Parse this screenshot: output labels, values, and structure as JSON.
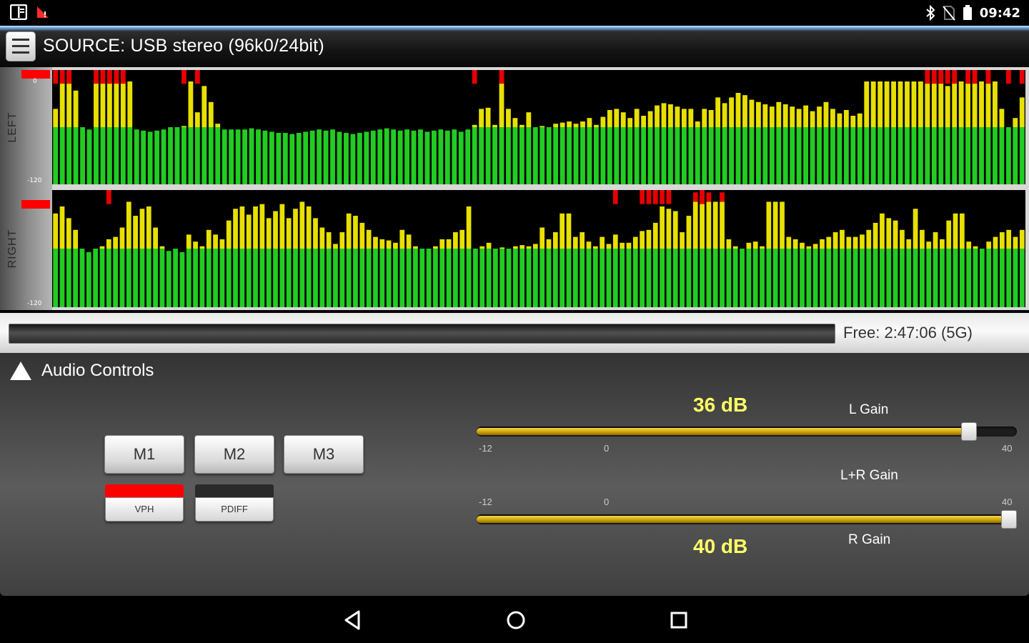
{
  "status_bar": {
    "left_icons": [
      "notes-icon",
      "signal-warning-icon"
    ],
    "right_icons": [
      "bluetooth-icon",
      "no-sim-icon",
      "battery-icon"
    ],
    "time": "09:42"
  },
  "header": {
    "source_label": "SOURCE: USB stereo (96k0/24bit)",
    "menu_icon": "hamburger-menu-icon"
  },
  "meters": {
    "scale_top": "0",
    "scale_bottom": "-120",
    "left": {
      "label": "LEFT",
      "levels": [
        0.66,
        0.9,
        0.9,
        0.82,
        0.5,
        0.48,
        0.9,
        0.9,
        0.9,
        0.9,
        0.9,
        0.9,
        0.48,
        0.47,
        0.46,
        0.47,
        0.48,
        0.5,
        0.5,
        0.51,
        0.9,
        0.63,
        0.86,
        0.72,
        0.53,
        0.48,
        0.48,
        0.48,
        0.48,
        0.49,
        0.48,
        0.47,
        0.46,
        0.45,
        0.45,
        0.44,
        0.45,
        0.46,
        0.47,
        0.48,
        0.47,
        0.48,
        0.46,
        0.45,
        0.44,
        0.45,
        0.46,
        0.47,
        0.48,
        0.49,
        0.48,
        0.47,
        0.48,
        0.47,
        0.48,
        0.46,
        0.47,
        0.48,
        0.47,
        0.48,
        0.46,
        0.48,
        0.52,
        0.66,
        0.67,
        0.52,
        0.9,
        0.66,
        0.58,
        0.52,
        0.63,
        0.5,
        0.51,
        0.5,
        0.53,
        0.54,
        0.55,
        0.53,
        0.55,
        0.58,
        0.52,
        0.59,
        0.65,
        0.66,
        0.63,
        0.58,
        0.66,
        0.6,
        0.64,
        0.69,
        0.71,
        0.7,
        0.68,
        0.66,
        0.66,
        0.55,
        0.66,
        0.65,
        0.76,
        0.71,
        0.76,
        0.8,
        0.78,
        0.74,
        0.72,
        0.7,
        0.68,
        0.72,
        0.7,
        0.68,
        0.66,
        0.69,
        0.64,
        0.68,
        0.72,
        0.66,
        0.62,
        0.65,
        0.6,
        0.62,
        0.9,
        0.9,
        0.9,
        0.9,
        0.9,
        0.9,
        0.9,
        0.9,
        0.9,
        0.9,
        0.9,
        0.9,
        0.86,
        0.9,
        0.9,
        0.9,
        0.9,
        0.9,
        0.9,
        0.9,
        0.66,
        0.5,
        0.58,
        0.76
      ],
      "peaks": [
        0,
        1,
        2,
        6,
        7,
        8,
        9,
        10,
        19,
        21,
        62,
        66,
        129,
        130,
        131,
        132,
        133,
        135,
        136,
        138,
        141,
        143,
        144,
        145
      ]
    },
    "right": {
      "label": "RIGHT",
      "levels": [
        0.8,
        0.86,
        0.76,
        0.66,
        0.5,
        0.47,
        0.5,
        0.52,
        0.58,
        0.6,
        0.68,
        0.9,
        0.78,
        0.84,
        0.86,
        0.68,
        0.52,
        0.48,
        0.5,
        0.47,
        0.62,
        0.56,
        0.52,
        0.66,
        0.62,
        0.58,
        0.74,
        0.84,
        0.86,
        0.79,
        0.86,
        0.88,
        0.76,
        0.82,
        0.88,
        0.76,
        0.84,
        0.9,
        0.86,
        0.76,
        0.68,
        0.64,
        0.54,
        0.64,
        0.8,
        0.78,
        0.72,
        0.66,
        0.6,
        0.58,
        0.57,
        0.55,
        0.66,
        0.62,
        0.52,
        0.5,
        0.5,
        0.52,
        0.58,
        0.58,
        0.64,
        0.66,
        0.86,
        0.5,
        0.52,
        0.55,
        0.5,
        0.51,
        0.5,
        0.52,
        0.53,
        0.52,
        0.54,
        0.68,
        0.58,
        0.64,
        0.8,
        0.8,
        0.6,
        0.64,
        0.56,
        0.52,
        0.6,
        0.54,
        0.62,
        0.55,
        0.55,
        0.6,
        0.65,
        0.66,
        0.72,
        0.86,
        0.84,
        0.82,
        0.64,
        0.78,
        0.98,
        0.98,
        0.98,
        0.9,
        0.98,
        0.58,
        0.52,
        0.5,
        0.55,
        0.56,
        0.52,
        0.9,
        0.9,
        0.9,
        0.6,
        0.58,
        0.55,
        0.52,
        0.54,
        0.58,
        0.6,
        0.64,
        0.66,
        0.6,
        0.6,
        0.62,
        0.66,
        0.72,
        0.8,
        0.76,
        0.74,
        0.66,
        0.58,
        0.84,
        0.66,
        0.56,
        0.64,
        0.58,
        0.74,
        0.8,
        0.8,
        0.56,
        0.52,
        0.5,
        0.56,
        0.6,
        0.64,
        0.66,
        0.6,
        0.66
      ],
      "peaks": [
        8,
        84,
        88,
        89,
        90,
        91,
        92,
        97
      ]
    }
  },
  "recording": {
    "free_label": "Free: 2:47:06 (5G)"
  },
  "audio_controls": {
    "title": "Audio Controls",
    "collapse_icon": "triangle-up-icon",
    "memory_buttons": [
      "M1",
      "M2",
      "M3"
    ],
    "toggles": [
      {
        "label": "VPH",
        "active": true,
        "color": "#ff0000"
      },
      {
        "label": "PDIFF",
        "active": false,
        "color": "#2a2a2a"
      }
    ],
    "l_gain": {
      "label": "L Gain",
      "value_text": "36 dB",
      "value": 36,
      "min": -12,
      "max": 40
    },
    "lr_gain": {
      "label": "L+R Gain"
    },
    "r_gain": {
      "label": "R Gain",
      "value_text": "40 dB",
      "value": 40,
      "min": -12,
      "max": 40
    },
    "ticks": {
      "min": "-12",
      "zero": "0",
      "max": "40"
    }
  },
  "nav_bar": {
    "icons": [
      "back-icon",
      "home-icon",
      "recents-icon"
    ]
  },
  "colors": {
    "meter_green": "#22cc22",
    "meter_yellow": "#e8e000",
    "meter_red": "#e60000",
    "gain_text": "#ffff66",
    "slider_gold": "#d9b000"
  }
}
